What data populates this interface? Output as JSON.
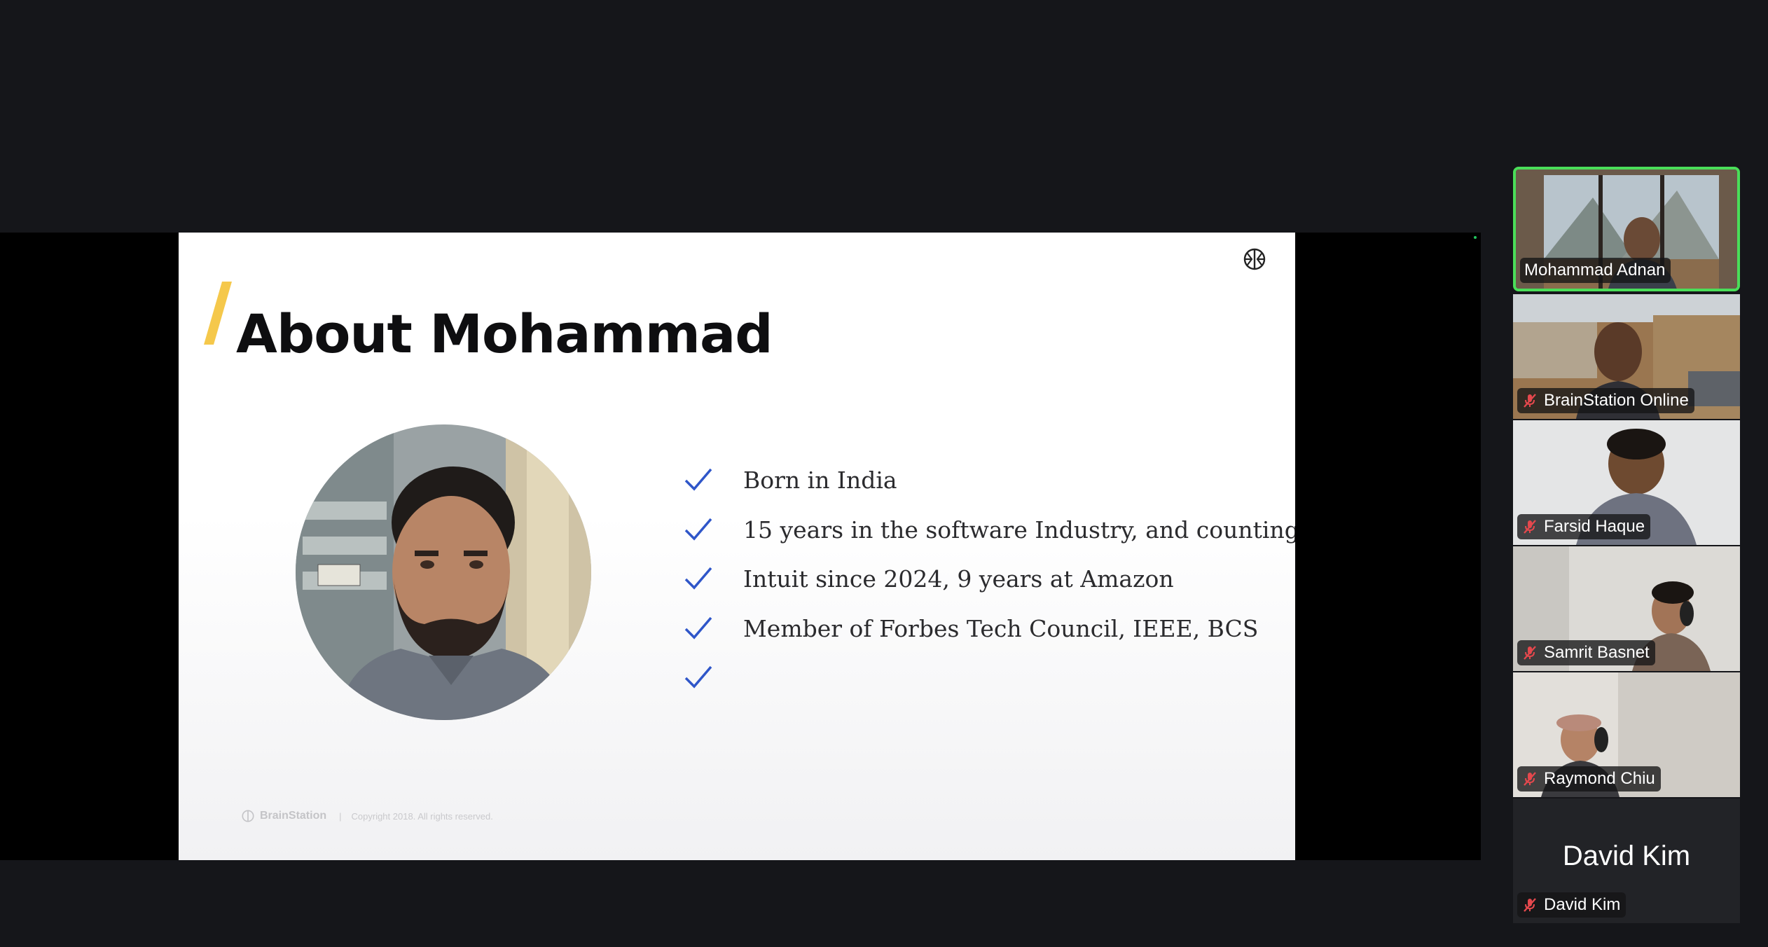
{
  "slide": {
    "title": "About Mohammad",
    "bullets": [
      "Born in India",
      "15 years in the software Industry, and counting.",
      "Intuit since 2024, 9 years at Amazon",
      "Member of Forbes Tech Council, IEEE, BCS",
      ""
    ],
    "footer": {
      "brand": "BrainStation",
      "separator": "|",
      "copyright": "Copyright 2018. All rights reserved."
    }
  },
  "participants": [
    {
      "name": "Mohammad Adnan",
      "muted": false,
      "active_speaker": true,
      "video": true
    },
    {
      "name": "BrainStation Online",
      "muted": true,
      "video": true
    },
    {
      "name": "Farsid Haque",
      "muted": true,
      "video": true
    },
    {
      "name": "Samrit Basnet",
      "muted": true,
      "video": true
    },
    {
      "name": "Raymond Chiu",
      "muted": true,
      "video": true
    },
    {
      "name": "David Kim",
      "muted": true,
      "video": false,
      "display_name": "David Kim"
    }
  ],
  "colors": {
    "background": "#15161a",
    "active_speaker_border": "#4ade59",
    "accent_slash": "#f5c84b",
    "check": "#2f56c9",
    "muted_mic": "#e5484d"
  },
  "icons": {
    "slide_logo": "brain-logo-icon",
    "check": "check-icon",
    "muted": "mic-off-icon"
  }
}
